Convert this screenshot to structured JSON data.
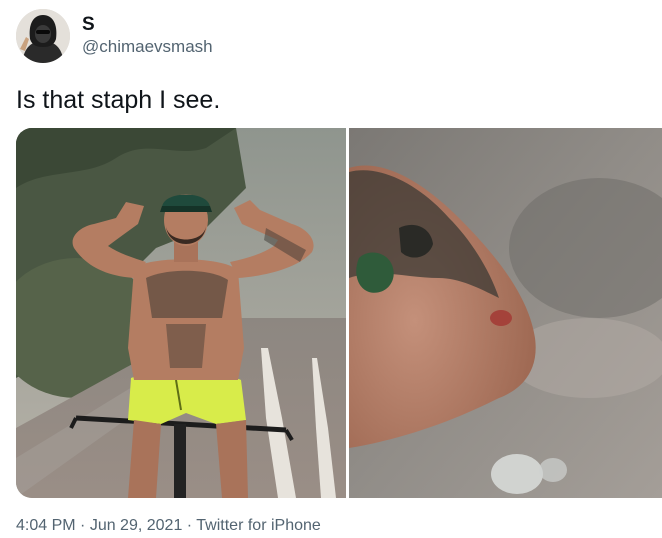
{
  "author": {
    "display_name": "S",
    "handle": "@chimaevsmash",
    "avatar_icon": "hooded-figure-avatar"
  },
  "tweet": {
    "text": "Is that staph I see."
  },
  "media": {
    "left_image": "shirtless-man-flexing-on-bicycle-photo",
    "right_image": "tattooed-elbow-closeup-photo"
  },
  "meta": {
    "time": "4:04 PM",
    "separator": " · ",
    "date": "Jun 29, 2021",
    "source": "Twitter for iPhone"
  },
  "colors": {
    "text_primary": "#0f1419",
    "text_secondary": "#536471",
    "background": "#ffffff"
  }
}
